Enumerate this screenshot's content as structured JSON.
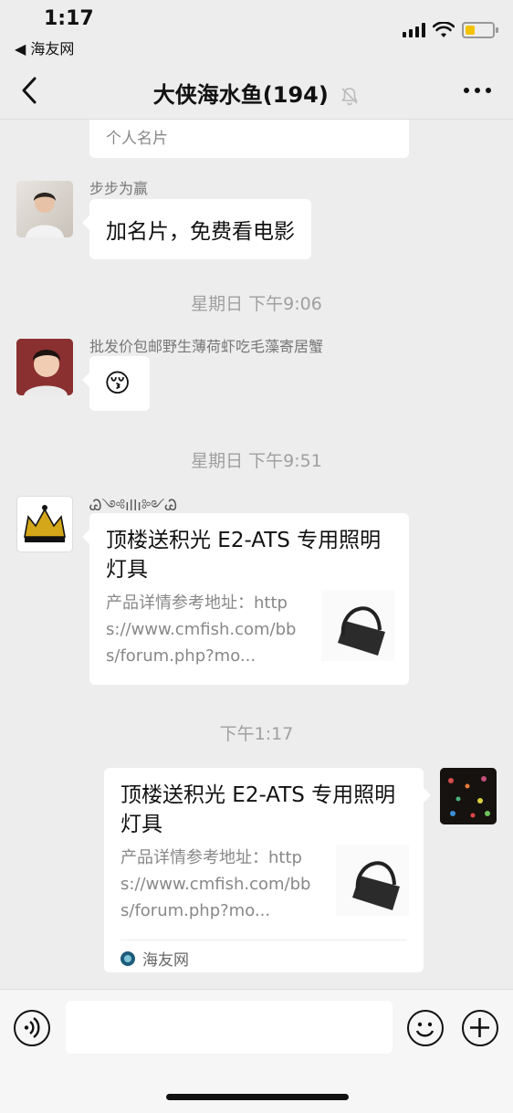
{
  "status_bar": {
    "time": "1:17",
    "back_app": "◀ 海友网"
  },
  "header": {
    "title": "大侠海水鱼(194)"
  },
  "messages": {
    "top_card_label": "个人名片",
    "m1": {
      "sender": "步步为赢",
      "text": "加名片，免费看电影"
    },
    "stamp1": "星期日 下午9:06",
    "m2": {
      "sender": "批发价包邮野生薄荷虾吃毛藻寄居蟹",
      "emoji": "😚"
    },
    "stamp2": "星期日 下午9:51",
    "m3": {
      "sender": "Ꮚ༺ıllı༻Ꮚ",
      "title": "顶楼送积光 E2-ATS 专用照明灯具",
      "desc": "产品详情参考地址：https://www.cmfish.com/bbs/forum.php?mo..."
    },
    "stamp3": "下午1:17",
    "m4": {
      "title": "顶楼送积光 E2-ATS 专用照明灯具",
      "desc": "产品详情参考地址：https://www.cmfish.com/bbs/forum.php?mo...",
      "source": "海友网"
    }
  },
  "input_bar": {
    "placeholder": ""
  },
  "colors": {
    "background": "#ededed",
    "bubble": "#ffffff",
    "timestamp": "#a0a0a0"
  }
}
